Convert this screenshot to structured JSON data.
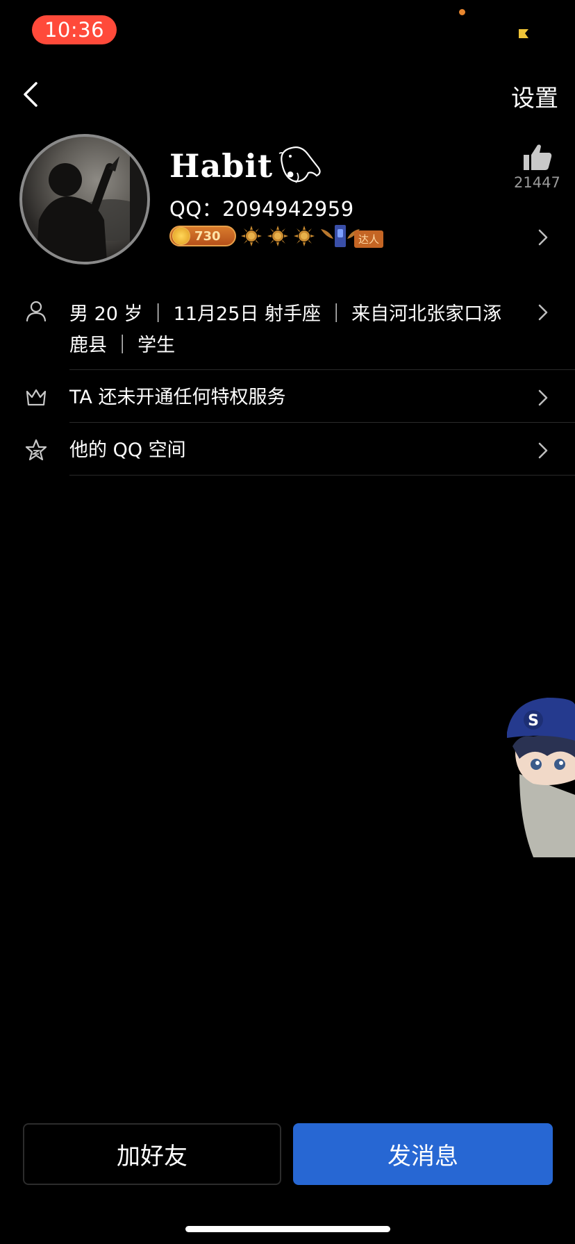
{
  "status_bar": {
    "time": "10:36"
  },
  "nav": {
    "settings_label": "设置"
  },
  "profile": {
    "nickname": "Habit .",
    "qq_line": "QQ：2094942959",
    "coin_badge_value": "730",
    "sun_level_count": 3,
    "daren_label": "达人",
    "like_count": "21447"
  },
  "info_rows": [
    {
      "icon": "person-icon",
      "text": "男 20 岁 ｜ 11月25日 射手座 ｜ 来自河北张家口涿鹿县 ｜ 学生"
    },
    {
      "icon": "crown-icon",
      "text": "TA 还未开通任何特权服务"
    },
    {
      "icon": "star-icon",
      "text": "他的 QQ 空间"
    }
  ],
  "buttons": {
    "add_friend": "加好友",
    "send_message": "发消息"
  },
  "colors": {
    "primary_button": "#2767d3",
    "status_time_bg": "#ff4a3a"
  }
}
